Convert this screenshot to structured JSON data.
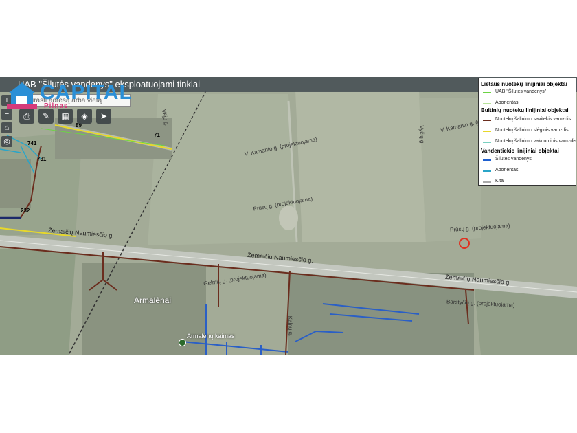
{
  "window": {
    "title": "UAB \"Šilutės vandenys\" eksploatuojami tinklai"
  },
  "logo": {
    "brand": "CAPITAL",
    "sub": "Pilnas"
  },
  "search": {
    "placeholder": "Surasti adresą arba vietą"
  },
  "toolbar": {
    "print_icon": "printer-icon",
    "edit_icon": "pencil-icon",
    "grid_icon": "grid-icon",
    "layers_icon": "layers-icon",
    "pin_icon": "pin-icon"
  },
  "side": {
    "zoom_in": "+",
    "zoom_out": "−",
    "home_icon": "home-icon",
    "locate_icon": "locate-icon"
  },
  "map": {
    "streets": {
      "main": "Žemaičių Naumiesčio g.",
      "main2": "Žemaičių Naumiesčio g.",
      "v_kamanto": "V. Kamanto g. (projektuojama)",
      "v_kamanto2": "V. Kamanto g. (projektuojama)",
      "pries": "Prūsų g. (projektuojama)",
      "pries2": "Prūsų g. (projektuojama)",
      "gelmiu": "Gelmių g. (projektuojama)",
      "barstyciu": "Barstyčių g. (projektuojama)",
      "vertical1": "Vyčių g.",
      "vertical2": "Vėjų g.",
      "center_v": "Kalnų g."
    },
    "places": {
      "armalenai": "Armalėnai",
      "kaimas": "Armalėnų kaimas"
    },
    "nodes": {
      "n1": "71",
      "n2": "741",
      "n3": "731",
      "n4": "232",
      "n5": "89"
    }
  },
  "legend": {
    "rain": {
      "title": "Lietaus nuotekų linijiniai objektai",
      "items": [
        {
          "label": "UAB \"Šilutės vandenys\"",
          "color": "#6cd444"
        },
        {
          "label": "Abonentas",
          "color": "#b7e39a"
        }
      ]
    },
    "sewage": {
      "title": "Buitinių nuotekų linijiniai objektai",
      "items": [
        {
          "label": "Nuotekų šalinimo savitekis vamzdis",
          "color": "#6b2d1e"
        },
        {
          "label": "Nuotekų šalinimo slėginis vamzdis",
          "color": "#e8d82a"
        },
        {
          "label": "Nuotekų šalinimo vakuuminis vamzdis",
          "color": "#7ad0c0"
        }
      ]
    },
    "water": {
      "title": "Vandentiekio linijiniai objektai",
      "items": [
        {
          "label": "Šilutės vandenys",
          "color": "#1d5fd0"
        },
        {
          "label": "Abonentas",
          "color": "#2aa5c8"
        },
        {
          "label": "Kita",
          "color": "#aaaaaa"
        }
      ]
    }
  }
}
